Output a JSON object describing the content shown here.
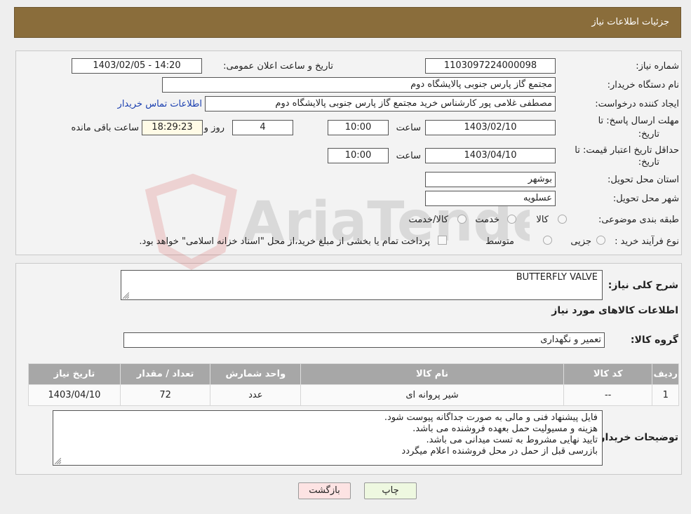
{
  "header": {
    "title": "جزئیات اطلاعات نیاز"
  },
  "form": {
    "need_number_label": "شماره نیاز:",
    "need_number": "1103097224000098",
    "announce_label": "تاریخ و ساعت اعلان عمومی:",
    "announce_value": "1403/02/05 - 14:20",
    "buyer_org_label": "نام دستگاه خریدار:",
    "buyer_org": "مجتمع گاز پارس جنوبی  پالایشگاه دوم",
    "creator_label": "ایجاد کننده درخواست:",
    "creator": "مصطفی غلامی پور کارشناس خرید مجتمع گاز پارس جنوبی  پالایشگاه دوم",
    "contact_link": "اطلاعات تماس خریدار",
    "deadline_label_1": "مهلت ارسال پاسخ: تا",
    "deadline_label_2": "تاریخ:",
    "deadline_date": "1403/02/10",
    "time_label": "ساعت",
    "deadline_time": "10:00",
    "days_value": "4",
    "days_label": "روز و",
    "remaining_time": "18:29:23",
    "remaining_label": "ساعت باقی مانده",
    "validity_label_1": "حداقل تاریخ اعتبار قیمت: تا",
    "validity_label_2": "تاریخ:",
    "validity_date": "1403/04/10",
    "validity_time": "10:00",
    "province_label": "استان محل تحویل:",
    "province": "بوشهر",
    "city_label": "شهر محل تحویل:",
    "city": "عسلویه",
    "category_label": "طبقه بندی موضوعی:",
    "category_options": [
      "کالا",
      "خدمت",
      "کالا/خدمت"
    ],
    "process_label": "نوع فرآیند خرید :",
    "process_options": [
      "جزیی",
      "متوسط"
    ],
    "process_note": "پرداخت تمام یا بخشی از مبلغ خرید،از محل \"اسناد خزانه اسلامی\" خواهد بود."
  },
  "details": {
    "summary_label": "شرح کلی نیاز:",
    "summary_value": "BUTTERFLY VALVE",
    "items_heading": "اطلاعات کالاهای مورد نیاز",
    "group_label": "گروه کالا:",
    "group_value": "تعمیر و نگهداری",
    "table": {
      "headers": [
        "ردیف",
        "کد کالا",
        "نام کالا",
        "واحد شمارش",
        "تعداد / مقدار",
        "تاریخ نیاز"
      ],
      "rows": [
        [
          "1",
          "--",
          "شیر پروانه ای",
          "عدد",
          "72",
          "1403/04/10"
        ]
      ]
    },
    "buyer_notes_label": "توضیحات خریدار:",
    "buyer_notes": [
      "فایل پیشنهاد فنی و مالی به صورت جداگانه پیوست شود.",
      "هزینه و مسیولیت حمل بعهده فروشنده می باشد.",
      "تایید نهایی مشروط به تست میدانی می باشد.",
      "بازرسی قبل از حمل در محل فروشنده اعلام میگردد"
    ]
  },
  "buttons": {
    "print": "چاپ",
    "back": "بازگشت"
  },
  "watermark_text": "AriaTender.neT",
  "colors": {
    "header_bg": "#8a6d3b",
    "link": "#1a3fb0",
    "print_btn": "#eef8e0",
    "back_btn": "#fde3e3"
  }
}
